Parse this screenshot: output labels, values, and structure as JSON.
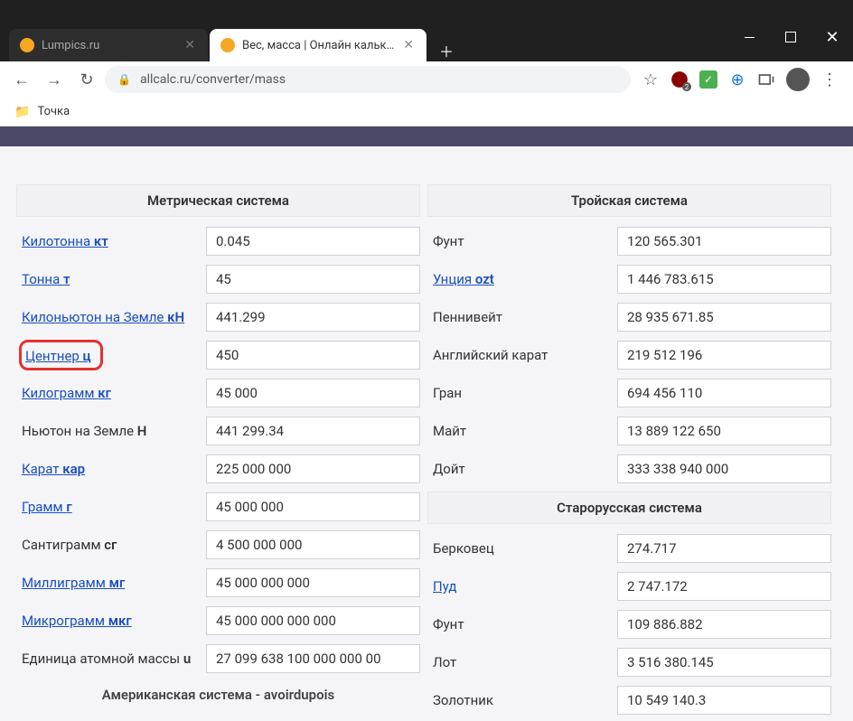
{
  "titlebar": {},
  "tabs": [
    {
      "title": "Lumpics.ru",
      "active": false,
      "favicon_color": "#f5a623"
    },
    {
      "title": "Вес, масса | Онлайн калькулято",
      "active": true,
      "favicon_color": "#f5a623"
    }
  ],
  "address": {
    "url": "allcalc.ru/converter/mass"
  },
  "bookmarks": {
    "folder_label": "Точка"
  },
  "page": {
    "left_header": "Метрическая система",
    "right_headers": {
      "troy": "Тройская система",
      "oldrussian": "Старорусская система"
    },
    "footer_left": "Американская система - avoirdupois",
    "left_rows": [
      {
        "label": "Килотонна",
        "abbr": "кт",
        "link": true,
        "value": "0.045",
        "highlight": false
      },
      {
        "label": "Тонна",
        "abbr": "т",
        "link": true,
        "value": "45",
        "highlight": false
      },
      {
        "label": "Килоньютон на Земле",
        "abbr": "кН",
        "link": true,
        "value": "441.299",
        "highlight": false
      },
      {
        "label": "Центнер",
        "abbr": "ц",
        "link": true,
        "value": "450",
        "highlight": true
      },
      {
        "label": "Килограмм",
        "abbr": "кг",
        "link": true,
        "value": "45 000",
        "highlight": false
      },
      {
        "label": "Ньютон на Земле",
        "abbr": "Н",
        "link": false,
        "value": "441 299.34",
        "highlight": false
      },
      {
        "label": "Карат",
        "abbr": "кар",
        "link": true,
        "value": "225 000 000",
        "highlight": false
      },
      {
        "label": "Грамм",
        "abbr": "г",
        "link": true,
        "value": "45 000 000",
        "highlight": false
      },
      {
        "label": "Сантиграмм",
        "abbr": "сг",
        "link": false,
        "value": "4 500 000 000",
        "highlight": false
      },
      {
        "label": "Миллиграмм",
        "abbr": "мг",
        "link": true,
        "value": "45 000 000 000",
        "highlight": false
      },
      {
        "label": "Микрограмм",
        "abbr": "мкг",
        "link": true,
        "value": "45 000 000 000 000",
        "highlight": false
      },
      {
        "label": "Единица атомной массы",
        "abbr": "u",
        "link": false,
        "value": "27 099 638 100 000 000 00",
        "highlight": false
      }
    ],
    "right_rows_troy": [
      {
        "label": "Фунт",
        "abbr": "",
        "link": false,
        "value": "120 565.301"
      },
      {
        "label": "Унция",
        "abbr": "ozt",
        "link": true,
        "value": "1 446 783.615"
      },
      {
        "label": "Пеннивейт",
        "abbr": "",
        "link": false,
        "value": "28 935 671.85"
      },
      {
        "label": "Английский карат",
        "abbr": "",
        "link": false,
        "value": "219 512 196"
      },
      {
        "label": "Гран",
        "abbr": "",
        "link": false,
        "value": "694 456 110"
      },
      {
        "label": "Майт",
        "abbr": "",
        "link": false,
        "value": "13 889 122 650"
      },
      {
        "label": "Дойт",
        "abbr": "",
        "link": false,
        "value": "333 338 940 000"
      }
    ],
    "right_rows_oldrussian": [
      {
        "label": "Берковец",
        "abbr": "",
        "link": false,
        "value": "274.717"
      },
      {
        "label": "Пуд",
        "abbr": "",
        "link": true,
        "value": "2 747.172"
      },
      {
        "label": "Фунт",
        "abbr": "",
        "link": false,
        "value": "109 886.882"
      },
      {
        "label": "Лот",
        "abbr": "",
        "link": false,
        "value": "3 516 380.145"
      },
      {
        "label": "Золотник",
        "abbr": "",
        "link": false,
        "value": "10 549 140.3"
      }
    ]
  }
}
